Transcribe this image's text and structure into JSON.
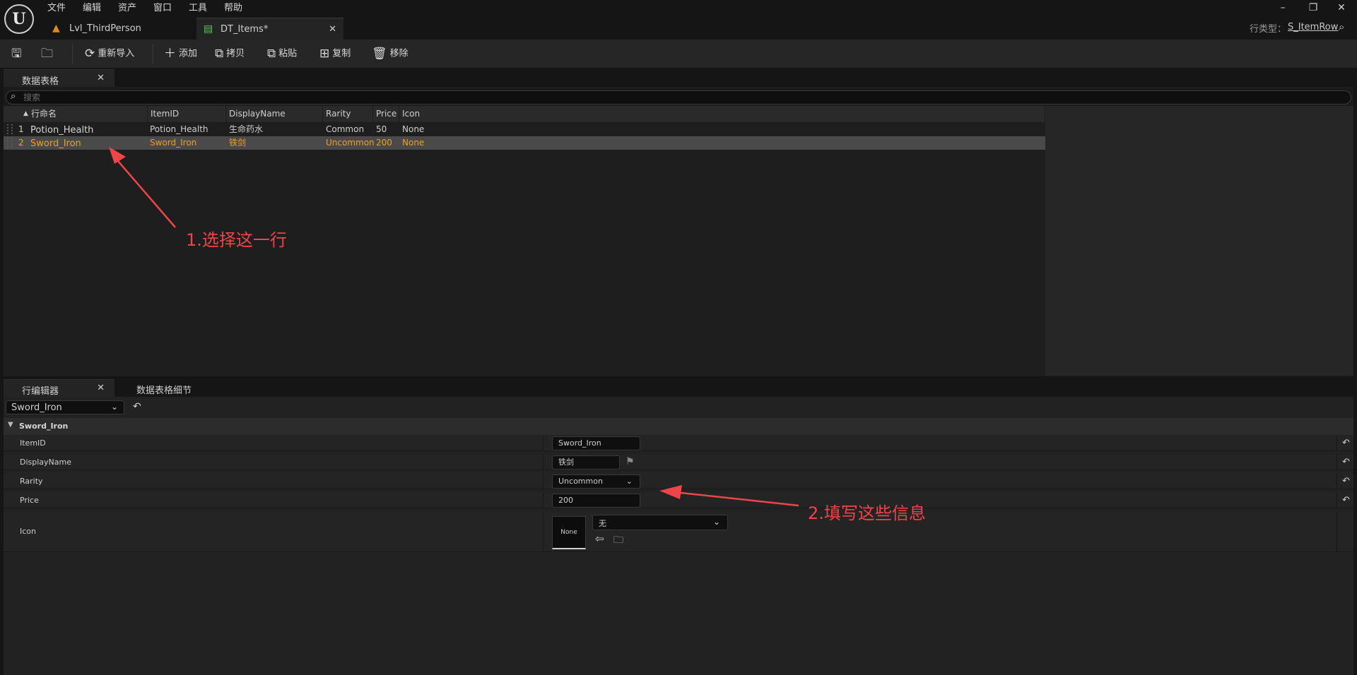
{
  "menu": [
    "文件",
    "编辑",
    "资产",
    "窗口",
    "工具",
    "帮助"
  ],
  "logo_text": "U",
  "tabs": [
    {
      "label": "Lvl_ThirdPerson",
      "icon": "level-icon"
    },
    {
      "label": "DT_Items*",
      "icon": "datatable-icon"
    }
  ],
  "row_type": {
    "label": "行类型：",
    "value": "S_ItemRow"
  },
  "toolbar": {
    "reimport": "重新导入",
    "add": "添加",
    "copy": "拷贝",
    "paste": "粘贴",
    "duplicate": "复制",
    "remove": "移除"
  },
  "data_table_tab": "数据表格",
  "search_placeholder": "搜索",
  "columns": [
    "行命名",
    "ItemID",
    "DisplayName",
    "Rarity",
    "Price",
    "Icon"
  ],
  "rows": [
    {
      "index": "1",
      "name": "Potion_Health",
      "item_id": "Potion_Health",
      "display_name": "生命药水",
      "rarity": "Common",
      "price": "50",
      "icon": "None"
    },
    {
      "index": "2",
      "name": "Sword_Iron",
      "item_id": "Sword_Iron",
      "display_name": "铁剑",
      "rarity": "Uncommon",
      "price": "200",
      "icon": "None"
    }
  ],
  "selected_row": 2,
  "annotation1": "1.选择这一行",
  "annotation2": "2.填写这些信息",
  "row_editor": {
    "tab": "行编辑器",
    "tab2": "数据表格细节",
    "selected": "Sword_Iron",
    "category": "Sword_Iron",
    "fields": {
      "item_id": {
        "label": "ItemID",
        "value": "Sword_Iron"
      },
      "display_name": {
        "label": "DisplayName",
        "value": "铁剑"
      },
      "rarity": {
        "label": "Rarity",
        "value": "Uncommon"
      },
      "price": {
        "label": "Price",
        "value": "200"
      },
      "icon": {
        "label": "Icon",
        "thumb": "None",
        "value": "无"
      }
    }
  },
  "colors": {
    "accent_orange": "#f0a020",
    "annotation_red": "#ef4448",
    "selected_row_bg": "#4a4a4a"
  }
}
